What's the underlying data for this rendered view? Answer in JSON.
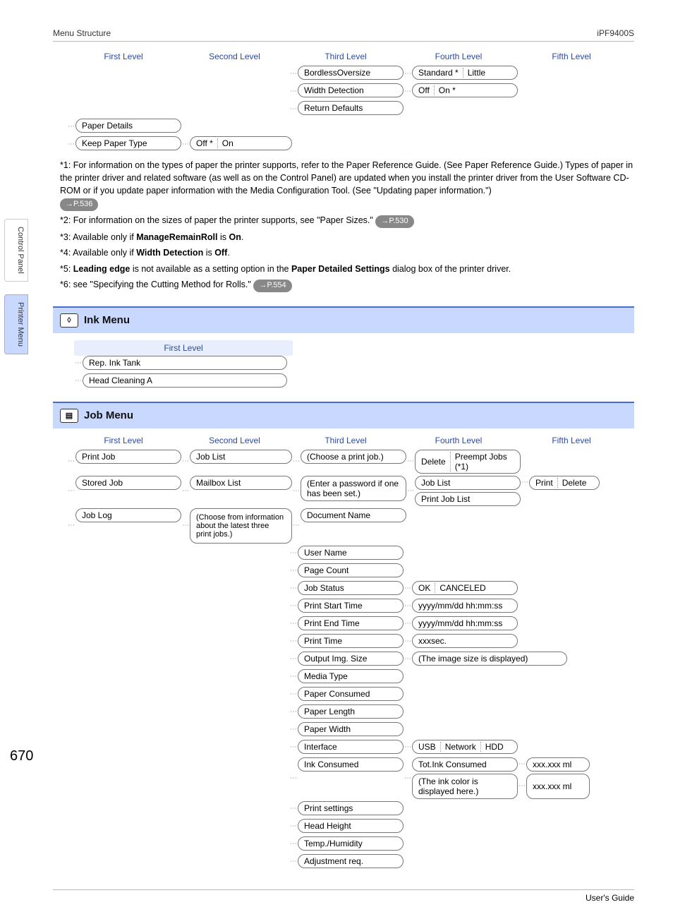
{
  "header": {
    "left": "Menu Structure",
    "right": "iPF9400S"
  },
  "footer": {
    "right": "User's Guide"
  },
  "page_number": "670",
  "side_tabs": {
    "a": "Control Panel",
    "b": "Printer Menu"
  },
  "levels": {
    "l1": "First Level",
    "l2": "Second Level",
    "l3": "Third Level",
    "l4": "Fourth Level",
    "l5": "Fifth Level"
  },
  "top_tree": {
    "r1c3": "BordlessOversize",
    "r1c4a": "Standard *",
    "r1c4b": "Little",
    "r2c3": "Width Detection",
    "r2c4a": "Off",
    "r2c4b": "On *",
    "r3c3": "Return Defaults",
    "r4c1": "Paper Details",
    "r5c1": "Keep Paper Type",
    "r5c2a": "Off *",
    "r5c2b": "On"
  },
  "notes": {
    "n1_pre": "*1: For information on the types of paper the printer supports, refer to the Paper Reference Guide. (See Paper Reference Guide.) Types of paper in the printer driver and related software (as well as on the Control Panel) are updated when you install the printer driver from the User Software CD-ROM or if you update paper information with the Media Configuration Tool.  (See \"Updating paper information.\")",
    "n1_pill": "→P.536",
    "n2_pre": "*2: For information on the sizes of paper the printer supports, see \"Paper Sizes.\"",
    "n2_pill": "→P.530",
    "n3_a": "*3: Available only if ",
    "n3_b": "ManageRemainRoll",
    "n3_c": " is ",
    "n3_d": "On",
    "n3_e": ".",
    "n4_a": "*4: Available only if ",
    "n4_b": "Width Detection",
    "n4_c": " is ",
    "n4_d": "Off",
    "n4_e": ".",
    "n5_a": "*5:  ",
    "n5_b": "Leading edge",
    "n5_c": " is not available as a setting option in the ",
    "n5_d": "Paper Detailed Settings",
    "n5_e": " dialog box of the printer driver.",
    "n6_pre": "*6: see \"Specifying the Cutting Method for Rolls.\"",
    "n6_pill": "→P.554"
  },
  "ink": {
    "title": "Ink Menu",
    "first_level_hdr": "First Level",
    "r1": "Rep. Ink Tank",
    "r2": "Head Cleaning A"
  },
  "job": {
    "title": "Job Menu",
    "rows": {
      "r1c1": "Print Job",
      "r1c2": "Job List",
      "r1c3": "(Choose a print job.)",
      "r1c4a": "Delete",
      "r1c4b": "Preempt Jobs (*1)",
      "r2c1": "Stored Job",
      "r2c2": "Mailbox List",
      "r2c3": "(Enter a password if one has been set.)",
      "r2c4": "Job List",
      "r2c5a": "Print",
      "r2c5b": "Delete",
      "r2bc4": "Print Job List",
      "r3c1": "Job Log",
      "r3c2": "(Choose from information about the latest three print jobs.)",
      "r3c3": "Document Name",
      "r4c3": "User Name",
      "r5c3": "Page Count",
      "r6c3": "Job Status",
      "r6c4a": "OK",
      "r6c4b": "CANCELED",
      "r7c3": "Print Start Time",
      "r7c4": "yyyy/mm/dd hh:mm:ss",
      "r8c3": "Print End Time",
      "r8c4": "yyyy/mm/dd hh:mm:ss",
      "r9c3": "Print Time",
      "r9c4": "xxxsec.",
      "r10c3": "Output Img. Size",
      "r10c4": "(The image size is displayed)",
      "r11c3": "Media Type",
      "r12c3": "Paper Consumed",
      "r13c3": "Paper Length",
      "r14c3": "Paper Width",
      "r15c3": "Interface",
      "r15c4a": "USB",
      "r15c4b": "Network",
      "r15c4c": "HDD",
      "r16c3": "Ink Consumed",
      "r16c4": "Tot.Ink Consumed",
      "r16c5": "xxx.xxx ml",
      "r16bc4": "(The ink color is displayed here.)",
      "r16bc5": "xxx.xxx ml",
      "r17c3": "Print settings",
      "r18c3": "Head Height",
      "r19c3": "Temp./Humidity",
      "r20c3": "Adjustment req."
    }
  }
}
